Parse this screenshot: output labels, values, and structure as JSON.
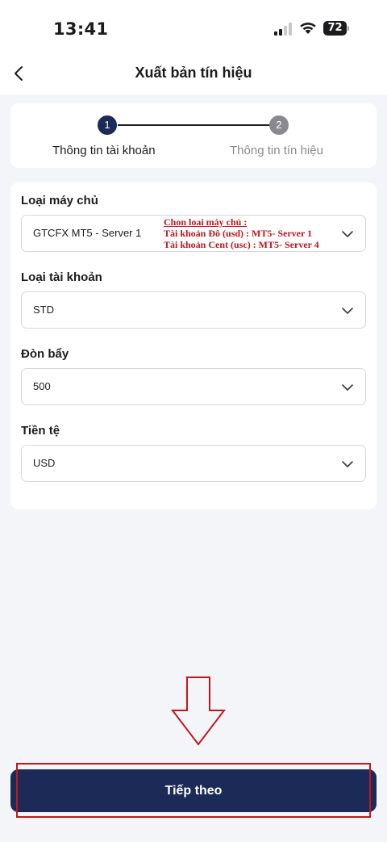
{
  "status_bar": {
    "time": "13:41",
    "battery": "72",
    "icons": [
      "signal-icon",
      "wifi-icon",
      "battery-icon"
    ]
  },
  "nav": {
    "back_icon": "chevron-left-icon",
    "title": "Xuất bản tín hiệu"
  },
  "stepper": {
    "steps": [
      {
        "number": "1",
        "label": "Thông tin tài khoản",
        "active": true
      },
      {
        "number": "2",
        "label": "Thông tin tín hiệu",
        "active": false
      }
    ]
  },
  "form": {
    "fields": [
      {
        "label": "Loại máy chủ",
        "value": "GTCFX MT5 - Server 1"
      },
      {
        "label": "Loại tài khoản",
        "value": "STD"
      },
      {
        "label": "Đòn bẩy",
        "value": "500"
      },
      {
        "label": "Tiền tệ",
        "value": "USD"
      }
    ],
    "server_note": {
      "title": "Chon loai máy chủ :",
      "line1": "Tài khoản Đô (usd) : MT5- Server 1",
      "line2": "Tài khoản Cent (usc) : MT5- Server 4"
    }
  },
  "footer": {
    "next_label": "Tiếp theo"
  },
  "colors": {
    "primary": "#1b2a56",
    "annotation": "#c4161c",
    "inactive": "#8a8a8e",
    "background": "#f4f5f9"
  }
}
